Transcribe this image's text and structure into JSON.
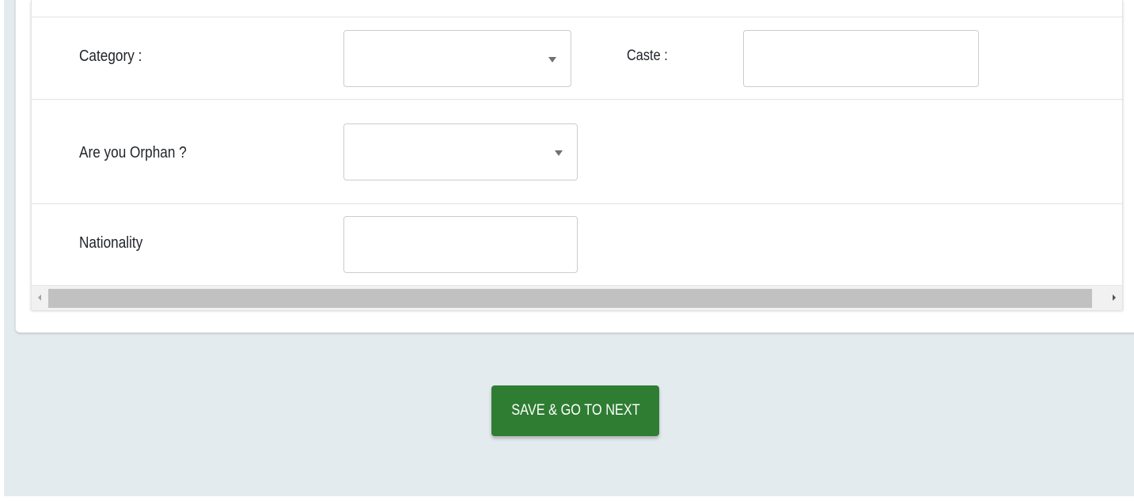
{
  "form": {
    "rows": [
      {
        "label": "Category :",
        "select_value": "",
        "second_label": "Caste :",
        "second_input_value": ""
      },
      {
        "label": "Are you Orphan ?",
        "select_value": ""
      },
      {
        "label": "Nationality",
        "input_value": ""
      }
    ]
  },
  "footer": {
    "save_label": "SAVE & GO TO NEXT"
  },
  "colors": {
    "page_background": "#e4ebef",
    "primary_button": "#2e7d32",
    "scrollbar_thumb": "#c1c1c1"
  }
}
